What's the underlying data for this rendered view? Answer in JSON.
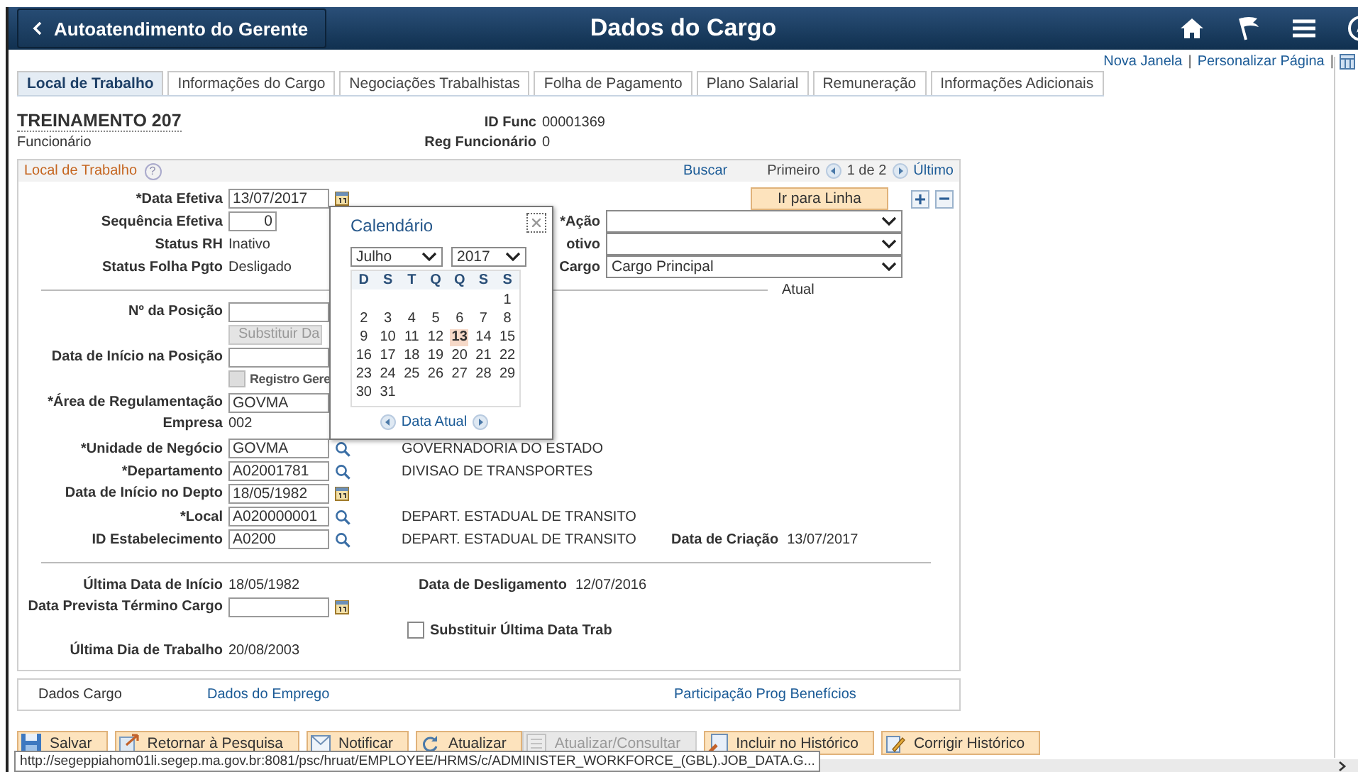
{
  "header": {
    "back_label": "Autoatendimento do Gerente",
    "title": "Dados do Cargo"
  },
  "top_links": [
    {
      "kind": "link",
      "label": "Nova Janela"
    },
    {
      "kind": "separator",
      "label": "|"
    },
    {
      "kind": "link",
      "label": "Personalizar Página"
    },
    {
      "kind": "separator",
      "label": "|"
    }
  ],
  "tabs": [
    {
      "label": "Local de Trabalho",
      "selected": true
    },
    {
      "label": "Informações do Cargo",
      "selected": false
    },
    {
      "label": "Negociações Trabalhistas",
      "selected": false
    },
    {
      "label": "Folha de Pagamento",
      "selected": false
    },
    {
      "label": "Plano Salarial",
      "selected": false
    },
    {
      "label": "Remuneração",
      "selected": false
    },
    {
      "label": "Informações Adicionais",
      "selected": false
    }
  ],
  "employee": {
    "name": "TREINAMENTO 207",
    "type": "Funcionário",
    "id_label": "ID Func",
    "id": "00001369",
    "reg_label": "Reg Funcionário",
    "reg": "0"
  },
  "section": {
    "title": "Local de Trabalho",
    "help": "?",
    "search": "Buscar",
    "first": "Primeiro",
    "count": "1 de 2",
    "last": "Último",
    "goto": "Ir para Linha"
  },
  "rows": [
    {
      "left": {
        "kind": "date",
        "label": "*Data Efetiva",
        "value": "13/07/2017"
      },
      "right": {
        "kind": "goto"
      }
    },
    {
      "left": {
        "kind": "number",
        "label": "Sequência Efetiva",
        "value": "0"
      },
      "right": {
        "kind": "select",
        "label": "*Ação"
      }
    },
    {
      "left": {
        "kind": "text",
        "label": "Status RH",
        "value": "Inativo"
      },
      "right": {
        "kind": "select",
        "label": "otivo"
      }
    },
    {
      "left": {
        "kind": "text",
        "label": "Status Folha Pgto",
        "value": "Desligado"
      },
      "right": {
        "kind": "select",
        "label": "Cargo",
        "value": "Cargo Principal"
      }
    },
    {
      "divider": {
        "label": "Atual"
      }
    },
    {
      "left": {
        "kind": "input",
        "label": "Nº da Posição"
      }
    },
    {
      "left": {
        "kind": "button",
        "value": "Substituir Da",
        "disabled": true
      }
    },
    {
      "left": {
        "kind": "input",
        "label": "Data de Início na Posição"
      }
    },
    {
      "left": {
        "kind": "checkbox",
        "value": "Registro Gere",
        "checked": false
      }
    },
    {
      "left": {
        "kind": "input",
        "label": "*Área de Regulamentação",
        "value": "GOVMA"
      }
    },
    {
      "left": {
        "kind": "text",
        "label": "Empresa",
        "value": "002"
      }
    },
    {
      "left": {
        "kind": "lookup",
        "label": "*Unidade de Negócio",
        "value": "GOVMA"
      },
      "mid": {
        "kind": "text",
        "value": "GOVERNADORIA DO ESTADO"
      }
    },
    {
      "left": {
        "kind": "lookup",
        "label": "*Departamento",
        "value": "A02001781"
      },
      "mid": {
        "kind": "text",
        "value": "DIVISAO DE TRANSPORTES"
      }
    },
    {
      "left": {
        "kind": "date",
        "label": "Data de Início no Depto",
        "value": "18/05/1982"
      }
    },
    {
      "left": {
        "kind": "lookup",
        "label": "*Local",
        "value": "A020000001"
      },
      "mid": {
        "kind": "text",
        "value": "DEPART. ESTADUAL DE TRANSITO"
      }
    },
    {
      "left": {
        "kind": "lookup",
        "label": "ID Estabelecimento",
        "value": "A0200"
      },
      "mid": {
        "kind": "text",
        "value": "DEPART. ESTADUAL DE TRANSITO"
      },
      "right": {
        "kind": "pair",
        "label": "Data de Criação",
        "value": "13/07/2017"
      }
    },
    {
      "divider": {}
    },
    {
      "left": {
        "kind": "text",
        "label": "Última Data de Início",
        "value": "18/05/1982"
      },
      "mid": {
        "kind": "pair",
        "label": "Data de Desligamento",
        "value": "12/07/2016"
      }
    },
    {
      "left": {
        "kind": "date",
        "label": "Data Prevista Término Cargo"
      }
    },
    {
      "mid": {
        "kind": "checkbox",
        "value": "Substituir Última Data Trab",
        "checked": false
      }
    },
    {
      "left": {
        "kind": "text",
        "label": "Última Dia de Trabalho",
        "value": "20/08/2003"
      }
    }
  ],
  "calendar": {
    "title": "Calendário",
    "month": "Julho",
    "year": "2017",
    "weekdays": [
      "D",
      "S",
      "T",
      "Q",
      "Q",
      "S",
      "S"
    ],
    "footer": "Data Atual",
    "weeks": [
      [
        {
          "day": "1",
          "selected": false
        }
      ],
      [
        {
          "day": "2",
          "selected": false
        },
        {
          "day": "3",
          "selected": false
        },
        {
          "day": "4",
          "selected": false
        },
        {
          "day": "5",
          "selected": false
        },
        {
          "day": "6",
          "selected": false
        },
        {
          "day": "7",
          "selected": false
        },
        {
          "day": "8",
          "selected": false
        }
      ],
      [
        {
          "day": "9",
          "selected": false
        },
        {
          "day": "10",
          "selected": false
        },
        {
          "day": "11",
          "selected": false
        },
        {
          "day": "12",
          "selected": false
        },
        {
          "day": "13",
          "selected": true
        },
        {
          "day": "14",
          "selected": false
        },
        {
          "day": "15",
          "selected": false
        }
      ],
      [
        {
          "day": "16",
          "selected": false
        },
        {
          "day": "17",
          "selected": false
        },
        {
          "day": "18",
          "selected": false
        },
        {
          "day": "19",
          "selected": false
        },
        {
          "day": "20",
          "selected": false
        },
        {
          "day": "21",
          "selected": false
        },
        {
          "day": "22",
          "selected": false
        }
      ],
      [
        {
          "day": "23",
          "selected": false
        },
        {
          "day": "24",
          "selected": false
        },
        {
          "day": "25",
          "selected": false
        },
        {
          "day": "26",
          "selected": false
        },
        {
          "day": "27",
          "selected": false
        },
        {
          "day": "28",
          "selected": false
        },
        {
          "day": "29",
          "selected": false
        }
      ],
      [
        {
          "day": "30",
          "selected": false
        },
        {
          "day": "31",
          "selected": false
        }
      ]
    ]
  },
  "links_box": [
    {
      "kind": "text",
      "label": "Dados Cargo"
    },
    {
      "kind": "link",
      "label": "Dados do Emprego"
    },
    {
      "kind": "link",
      "label": "Participação Prog Benefícios"
    }
  ],
  "toolbar": {
    "left": [
      {
        "kind": "save",
        "label": "Salvar",
        "disabled": false
      },
      {
        "kind": "return",
        "label": "Retornar à Pesquisa",
        "disabled": false
      },
      {
        "kind": "notify",
        "label": "Notificar",
        "disabled": false
      },
      {
        "kind": "refresh",
        "label": "Atualizar",
        "disabled": false
      }
    ],
    "right": [
      {
        "kind": "view",
        "label": "Atualizar/Consultar",
        "disabled": true
      },
      {
        "kind": "insert",
        "label": "Incluir no Histórico",
        "disabled": false
      },
      {
        "kind": "correct",
        "label": "Corrigir Histórico",
        "disabled": false
      }
    ]
  },
  "status_url": "http://segeppiahom01li.segep.ma.gov.br:8081/psc/hruat/EMPLOYEE/HRMS/c/ADMINISTER_WORKFORCE_(GBL).JOB_DATA.G..."
}
